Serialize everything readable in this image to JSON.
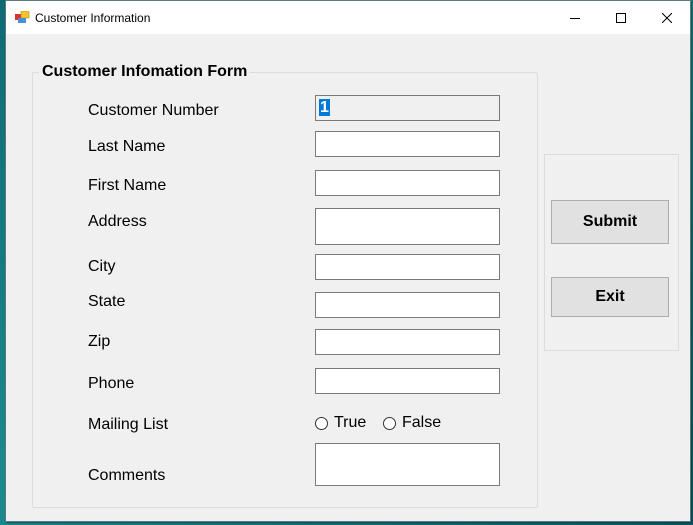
{
  "window": {
    "title": "Customer Information",
    "icon": "form-app-icon",
    "controls": [
      "minimize",
      "maximize",
      "close"
    ]
  },
  "form": {
    "group_title": "Customer Infomation Form",
    "fields": [
      {
        "label": "Customer Number",
        "value": "1",
        "placeholder": "",
        "readonly": true
      },
      {
        "label": "Last Name",
        "value": "",
        "placeholder": ""
      },
      {
        "label": "First Name",
        "value": "",
        "placeholder": ""
      },
      {
        "label": "Address",
        "value": "",
        "placeholder": ""
      },
      {
        "label": "City",
        "value": "",
        "placeholder": ""
      },
      {
        "label": "State",
        "value": "",
        "placeholder": ""
      },
      {
        "label": "Zip",
        "value": "",
        "placeholder": ""
      },
      {
        "label": "Phone",
        "value": "",
        "placeholder": ""
      }
    ],
    "mailing_list": {
      "label": "Mailing List",
      "options": [
        {
          "label": "True",
          "checked": false
        },
        {
          "label": "False",
          "checked": false
        }
      ]
    },
    "comments": {
      "label": "Comments",
      "value": ""
    }
  },
  "actions": {
    "submit_label": "Submit",
    "exit_label": "Exit"
  }
}
